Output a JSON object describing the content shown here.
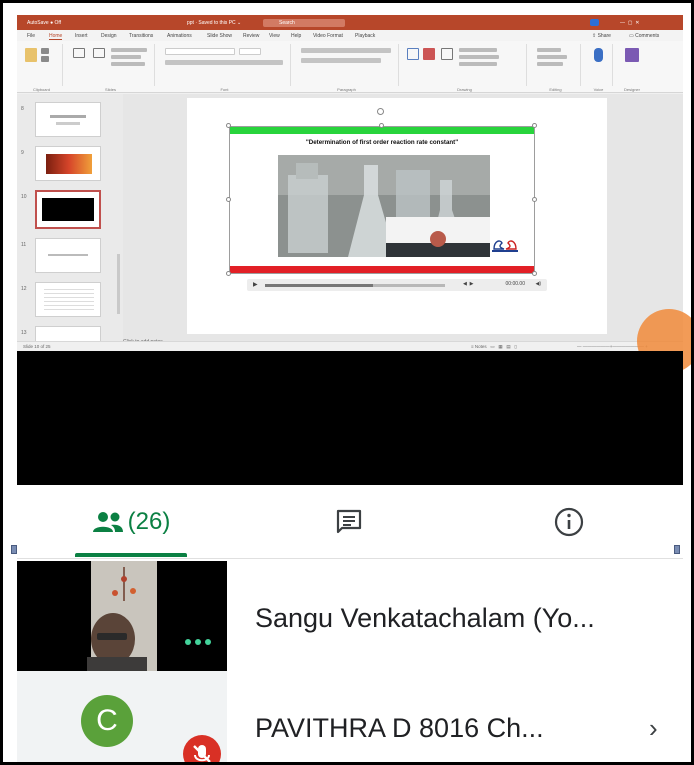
{
  "ppt": {
    "title": "Determination of first order reaction rate constant",
    "video_title": "\"Determination of first order reaction rate constant\"",
    "search_placeholder": "Search",
    "tabs": [
      "File",
      "Home",
      "Insert",
      "Design",
      "Transitions",
      "Animations",
      "Slide Show",
      "Review",
      "View",
      "Help",
      "Video Format",
      "Playback"
    ],
    "active_tab": "Home",
    "ribbon_groups": [
      "Clipboard",
      "Slides",
      "Font",
      "Paragraph",
      "Drawing",
      "Editing",
      "Voice",
      "Designer"
    ],
    "thumbnail_numbers": [
      "8",
      "9",
      "10",
      "11",
      "12",
      "13"
    ],
    "selected_slide": "10",
    "notes_placeholder": "Click to add notes",
    "status_left": "Slide 10 of 25",
    "video_time": "00:00.00",
    "video_progress": 0.6,
    "colors": {
      "title_bar": "#b7472a",
      "green_band": "#28d43c",
      "red_band": "#e22026"
    }
  },
  "meet": {
    "people_tab": {
      "icon": "people-icon",
      "count": "(26)"
    },
    "chat_tab": {
      "icon": "chat-icon"
    },
    "info_tab": {
      "icon": "info-icon"
    },
    "accent": "#0b8043",
    "participants": [
      {
        "name": "Sangu Venkatachalam (Yo...",
        "tile": "video",
        "more_icon": "more-dots-icon"
      },
      {
        "name": "PAVITHRA D 8016 Ch...",
        "avatar_letter": "C",
        "avatar_color": "#5aa13a",
        "mic": "mic-off-icon",
        "chevron": "chevron-right-icon"
      }
    ]
  }
}
